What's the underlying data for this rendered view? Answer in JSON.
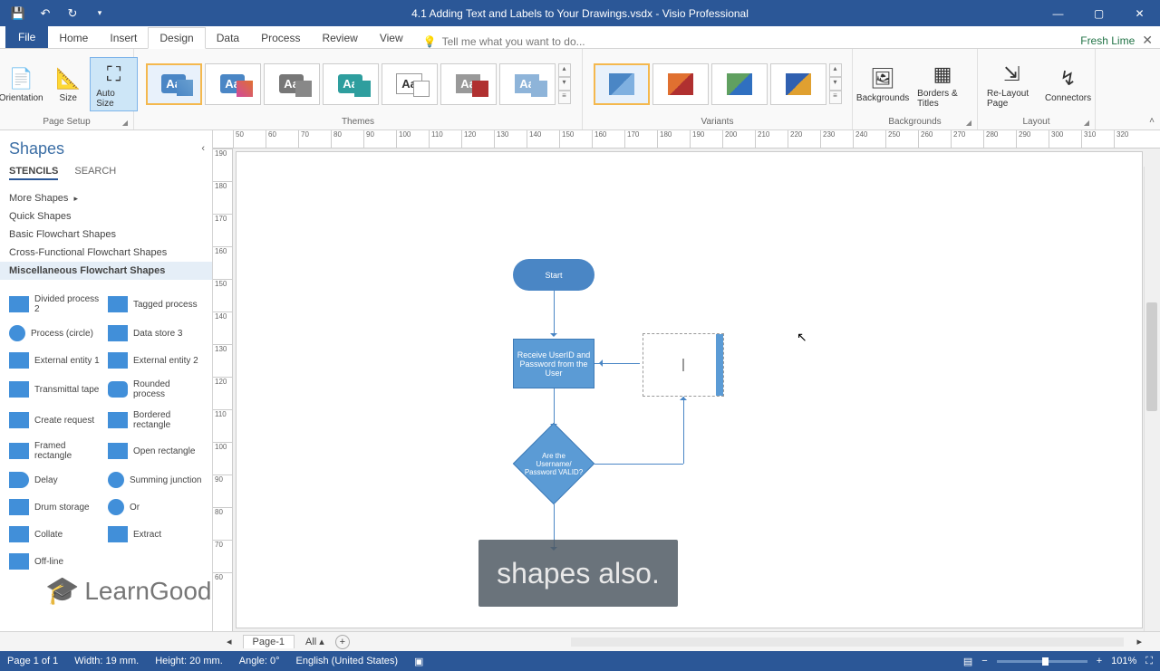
{
  "titlebar": {
    "title": "4.1 Adding Text and Labels to Your Drawings.vsdx - Visio Professional"
  },
  "ribbon_tabs": {
    "file": "File",
    "home": "Home",
    "insert": "Insert",
    "design": "Design",
    "data": "Data",
    "process": "Process",
    "review": "Review",
    "view": "View",
    "tellme_placeholder": "Tell me what you want to do...",
    "fresh_lime": "Fresh Lime"
  },
  "ribbon": {
    "page_setup": {
      "orientation": "Orientation",
      "size": "Size",
      "autosize": "Auto Size",
      "label": "Page Setup"
    },
    "themes": {
      "label": "Themes"
    },
    "variants": {
      "label": "Variants"
    },
    "backgrounds": {
      "btn": "Backgrounds",
      "borders": "Borders & Titles",
      "label": "Backgrounds"
    },
    "layout": {
      "relayout": "Re-Layout Page",
      "connectors": "Connectors",
      "label": "Layout"
    }
  },
  "shapes_panel": {
    "title": "Shapes",
    "stencils": "STENCILS",
    "search": "SEARCH",
    "stencil_list": {
      "more": "More Shapes",
      "quick": "Quick Shapes",
      "basic": "Basic Flowchart Shapes",
      "cross": "Cross-Functional Flowchart Shapes",
      "misc": "Miscellaneous Flowchart Shapes"
    },
    "shapes": {
      "divided_process_2": "Divided process 2",
      "tagged_process": "Tagged process",
      "process_circle": "Process (circle)",
      "data_store_3": "Data store 3",
      "external_entity_1": "External entity 1",
      "external_entity_2": "External entity 2",
      "transmittal_tape": "Transmittal tape",
      "rounded_process": "Rounded process",
      "create_request": "Create request",
      "bordered_rectangle": "Bordered rectangle",
      "framed_rectangle": "Framed rectangle",
      "open_rectangle": "Open rectangle",
      "delay": "Delay",
      "summing_junction": "Summing junction",
      "drum_storage": "Drum storage",
      "or": "Or",
      "collate": "Collate",
      "extract": "Extract",
      "offline": "Off-line"
    }
  },
  "ruler_h": [
    "50",
    "60",
    "70",
    "80",
    "90",
    "100",
    "110",
    "120",
    "130",
    "140",
    "150",
    "160",
    "170",
    "180",
    "190",
    "200",
    "210",
    "220",
    "230",
    "240",
    "250",
    "260",
    "270",
    "280",
    "290",
    "300",
    "310",
    "320"
  ],
  "ruler_v": [
    "190",
    "180",
    "170",
    "160",
    "150",
    "140",
    "130",
    "120",
    "110",
    "100",
    "90",
    "80",
    "70",
    "60"
  ],
  "flowchart": {
    "start": "Start",
    "receive": "Receive UserID and Password from the User",
    "valid": "Are the Username/ Password VALID?"
  },
  "caption": "shapes also.",
  "watermark": "LearnGood",
  "page_tabs": {
    "page1": "Page-1",
    "all": "All",
    "add": "+"
  },
  "statusbar": {
    "page": "Page 1 of 1",
    "width": "Width: 19 mm.",
    "height": "Height: 20 mm.",
    "angle": "Angle: 0°",
    "lang": "English (United States)",
    "zoom": "101%"
  }
}
